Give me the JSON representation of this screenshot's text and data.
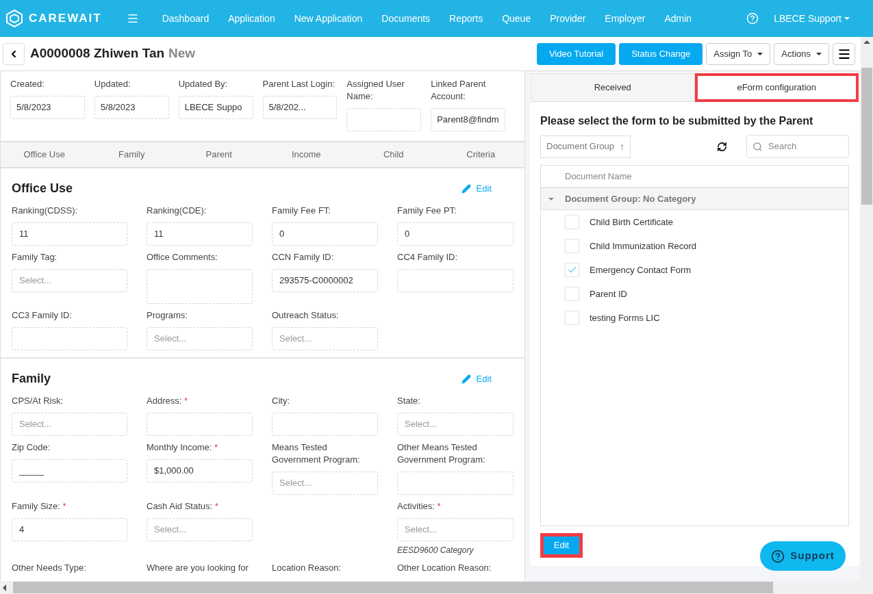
{
  "nav": {
    "brand": "CAREWAIT",
    "items": [
      "Dashboard",
      "Application",
      "New Application",
      "Documents",
      "Reports",
      "Queue",
      "Provider",
      "Employer",
      "Admin"
    ],
    "user": "LBECE Support"
  },
  "header": {
    "record_id": "A0000008 Zhiwen Tan",
    "status": "New",
    "buttons": [
      {
        "label": "Video Tutorial",
        "kind": "primary"
      },
      {
        "label": "Status Change",
        "kind": "primary"
      },
      {
        "label": "Assign To",
        "kind": "dropdown"
      },
      {
        "label": "Actions",
        "kind": "dropdown"
      }
    ]
  },
  "summary": [
    {
      "label": "Created:",
      "value": "5/8/2023"
    },
    {
      "label": "Updated:",
      "value": "5/8/2023"
    },
    {
      "label": "Updated By:",
      "value": "LBECE Suppo"
    },
    {
      "label": "Parent Last Login:",
      "value": "5/8/202..."
    },
    {
      "label": "Assigned User Name:"
    },
    {
      "label": "Linked Parent Account:",
      "value": "Parent8@findm"
    }
  ],
  "section_tabs": [
    {
      "label": "Office Use",
      "selected": false
    },
    {
      "label": "Family",
      "selected": false
    },
    {
      "label": "Parent",
      "selected": false
    },
    {
      "label": "Income",
      "selected": false
    },
    {
      "label": "Child",
      "selected": false
    },
    {
      "label": "Criteria",
      "selected": false
    }
  ],
  "sections": [
    {
      "title": "Office Use",
      "edit": "Edit",
      "rows": [
        [
          {
            "kind": "input",
            "label": "Ranking(CDSS):",
            "value": "11",
            "required": false
          },
          {
            "kind": "input",
            "label": "Ranking(CDE):",
            "value": "11",
            "required": false
          },
          {
            "kind": "input",
            "label": "Family Fee FT:",
            "value": "0",
            "required": false
          },
          {
            "kind": "input",
            "label": "Family Fee PT:",
            "value": "0",
            "required": false
          }
        ],
        [
          {
            "kind": "select",
            "label": "Family Tag:",
            "placeholder": "Select...",
            "required": false
          },
          {
            "kind": "textarea",
            "label": "Office Comments:",
            "required": false
          },
          {
            "kind": "input",
            "label": "CCN Family ID:",
            "value": "293575-C0000002",
            "required": false
          },
          {
            "kind": "input",
            "label": "CC4 Family ID:",
            "required": false
          }
        ],
        [
          {
            "kind": "input",
            "label": "CC3 Family ID:",
            "required": false
          },
          {
            "kind": "select",
            "label": "Programs:",
            "placeholder": "Select...",
            "required": false
          },
          {
            "kind": "select",
            "label": "Outreach Status:",
            "placeholder": "Select...",
            "required": false
          }
        ]
      ]
    },
    {
      "title": "Family",
      "edit": "Edit",
      "rows": [
        [
          {
            "kind": "select",
            "label": "CPS/At Risk:",
            "placeholder": "Select...",
            "required": false
          },
          {
            "kind": "input",
            "label": "Address:",
            "required": true
          },
          {
            "kind": "input",
            "label": "City:",
            "required": false
          },
          {
            "kind": "select",
            "label": "State:",
            "placeholder": "Select...",
            "required": false
          }
        ],
        [
          {
            "kind": "input",
            "label": "Zip Code:",
            "value": "_____",
            "required": false
          },
          {
            "kind": "input",
            "label": "Monthly Income:",
            "value": "$1,000.00",
            "required": true
          },
          {
            "kind": "select",
            "label": "Means Tested Government Program:",
            "placeholder": "Select...",
            "required": false
          },
          {
            "kind": "input",
            "label": "Other Means Tested Government Program:",
            "required": false
          }
        ],
        [
          {
            "kind": "input",
            "label": "Family Size:",
            "value": "4",
            "required": true
          },
          {
            "kind": "select",
            "label": "Cash Aid Status:",
            "placeholder": "Select...",
            "required": true
          },
          {
            "kind": "blank"
          },
          {
            "kind": "select",
            "label": "Activities:",
            "placeholder": "Select...",
            "required": true,
            "note": "EESD9600 Category"
          }
        ],
        [
          {
            "kind": "label",
            "label": "Other Needs Type:"
          },
          {
            "kind": "label",
            "label": "Where are you looking for"
          },
          {
            "kind": "label",
            "label": "Location Reason:"
          },
          {
            "kind": "label",
            "label": "Other Location Reason:"
          }
        ]
      ]
    }
  ],
  "eform": {
    "tabs": [
      {
        "label": "Received",
        "selected": false,
        "highlighted": false
      },
      {
        "label": "eForm configuration",
        "selected": true,
        "highlighted": true
      }
    ],
    "heading": "Please select the form to be submitted by the Parent",
    "sort_chip": {
      "label": "Document Group",
      "arrow": "↑"
    },
    "search": {
      "placeholder": "Search"
    },
    "column": "Document Name",
    "group": {
      "label": "Document Group: No Category",
      "expanded": true,
      "items": [
        {
          "name": "Child Birth Certificate",
          "checked": false
        },
        {
          "name": "Child Immunization Record",
          "checked": false
        },
        {
          "name": "Emergency Contact Form",
          "checked": true
        },
        {
          "name": "Parent ID",
          "checked": false
        },
        {
          "name": "testing Forms LIC",
          "checked": false
        }
      ]
    },
    "edit_button": {
      "label": "Edit",
      "highlighted": true
    }
  },
  "support": "Support",
  "required_mark": "*"
}
